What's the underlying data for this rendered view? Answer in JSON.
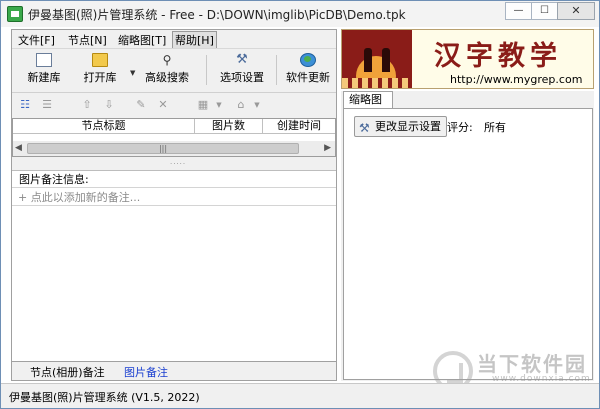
{
  "window": {
    "title": "伊曼基图(照)片管理系统 - Free - D:\\DOWN\\imglib\\PicDB\\Demo.tpk",
    "min_glyph": "—",
    "max_glyph": "☐",
    "close_glyph": "✕"
  },
  "menu": [
    {
      "label": "文件[F]"
    },
    {
      "label": "节点[N]"
    },
    {
      "label": "缩略图[T]"
    },
    {
      "label": "帮助[H]"
    }
  ],
  "toolbar": {
    "new_db": "新建库",
    "open_db": "打开库",
    "advanced_search": "高级搜索",
    "options": "选项设置",
    "update": "软件更新"
  },
  "grid": {
    "columns": [
      "节点标题",
      "图片数",
      "创建时间"
    ]
  },
  "notes": {
    "label": "图片备注信息:",
    "add_placeholder": "+ 点此以添加新的备注..."
  },
  "bottom_tabs": {
    "node_notes": "节点(相册)备注",
    "image_notes": "图片备注"
  },
  "banner": {
    "title": "汉字教学",
    "url": "http://www.mygrep.com"
  },
  "thumbnails": {
    "tab": "缩略图",
    "display_settings": "更改显示设置",
    "rating_label": "评分:",
    "rating_value": "所有"
  },
  "status": {
    "text": "伊曼基图(照)片管理系统 (V1.5, 2022)"
  },
  "watermark": {
    "title": "当下软件园",
    "url": "www.downxia.com"
  },
  "colors": {
    "accent_blue": "#1a3fd0",
    "banner_red": "#8a1c18"
  }
}
